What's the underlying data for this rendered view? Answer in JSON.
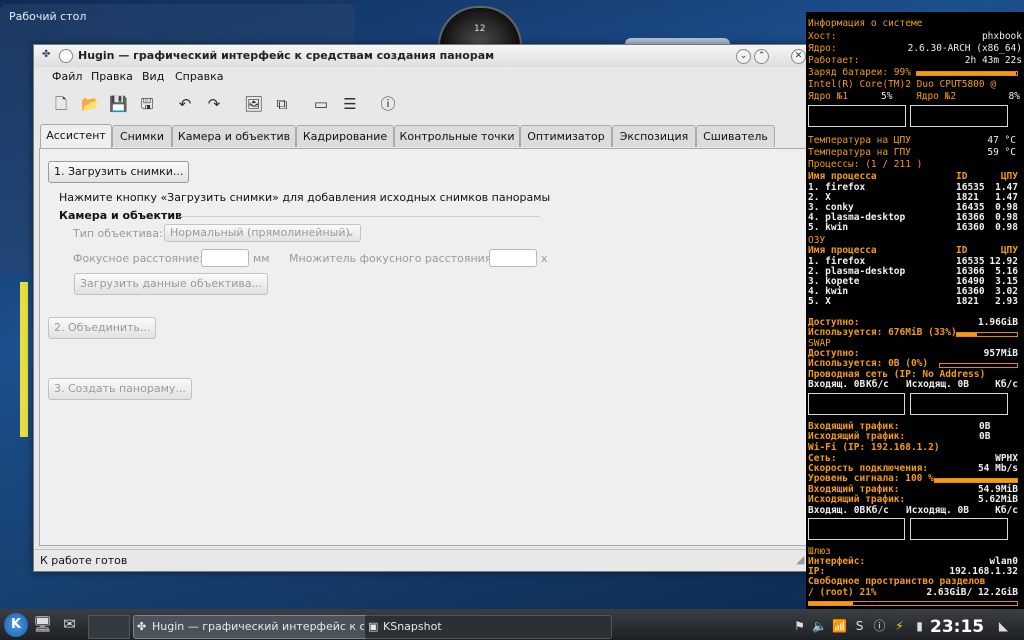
{
  "desktop": {
    "folder_title": "Рабочий стол",
    "clock_label": "12"
  },
  "window": {
    "title": "Hugin — графический интерфейс к средствам создания панорам",
    "menu": [
      "Файл",
      "Правка",
      "Вид",
      "Справка"
    ],
    "tabs": [
      "Ассистент",
      "Снимки",
      "Камера и объектив",
      "Кадрирование",
      "Контрольные точки",
      "Оптимизатор",
      "Экспозиция",
      "Сшиватель"
    ],
    "assistant": {
      "load_images_button": "1. Загрузить снимки...",
      "hint": "Нажмите кнопку «Загрузить снимки» для добавления исходных снимков панорамы",
      "camera_section": "Камера и объектив",
      "lens_type_label": "Тип объектива:",
      "lens_type_value": "Нормальный (прямолинейный)",
      "focal_length_label": "Фокусное расстояние:",
      "focal_unit": "мм",
      "multiplier_label": "Множитель фокусного расстояния:",
      "multiplier_unit": "x",
      "load_lens_button": "Загрузить данные объектива...",
      "align_button": "2. Объединить...",
      "create_button": "3. Создать панораму..."
    },
    "status": "К работе готов"
  },
  "conky": {
    "sysinfo_header": "Информация о системе",
    "host_label": "Хост:",
    "host_value": "phxbook",
    "kernel_label": "Ядро:",
    "kernel_value": "2.6.30-ARCH (x86_64)",
    "uptime_label": "Работает:",
    "uptime_value": "2h 43m 22s",
    "battery_text": "Заряд батареи: 99%",
    "cpu_model": "Intel(R) Core(TM)2 Duo CPU",
    "cpu_code": "T5800 @",
    "core1_text": "Ядро №1",
    "core1_pct": "5%",
    "core2_text": "Ядро №2",
    "core2_pct": "8%",
    "cpu_temp_label": "Температура на ЦПУ",
    "cpu_temp": "47 °C",
    "gpu_temp_label": "Температура на ГПУ",
    "gpu_temp": "59 °C",
    "proc_count": "Процессы: (1  / 211 )",
    "proc_header_name": "Имя процесса",
    "proc_header_id": "ID",
    "proc_header_cpu": "ЦПУ",
    "cpu_procs": [
      [
        "1. firefox",
        "16535",
        "1.47"
      ],
      [
        "2. X",
        "1821",
        "1.47"
      ],
      [
        "3. conky",
        "16435",
        "0.98"
      ],
      [
        "4. plasma-desktop",
        "16366",
        "0.98"
      ],
      [
        "5. kwin",
        "16360",
        "0.98"
      ]
    ],
    "ram_header": "ОЗУ",
    "mem_header_name": "Имя процесса",
    "mem_header_id": "ID",
    "mem_header_cpu": "ЦПУ",
    "mem_procs": [
      [
        "1. firefox",
        "16535",
        "12.92"
      ],
      [
        "2. plasma-desktop",
        "16366",
        "5.16"
      ],
      [
        "3. kopete",
        "16490",
        "3.15"
      ],
      [
        "4. kwin",
        "16360",
        "3.02"
      ],
      [
        "5. X",
        "1821",
        "2.93"
      ]
    ],
    "ram_avail_label": "Доступно:",
    "ram_avail": "1.96GiB",
    "ram_used": "Используется: 676MiB  (33%)",
    "swap_header": "SWAP",
    "swap_avail_label": "Доступно:",
    "swap_avail": "957MiB",
    "swap_used": "Используется: 0B    (0%)",
    "wired_header": "Проводная сеть (IP: No Address)",
    "in_label": "Входящ. 0B",
    "in_unit": "Кб/с",
    "out_label": "Исходящ. 0B",
    "out_unit": "Кб/с",
    "wired_in_traffic_label": "Входящий трафик:",
    "wired_in_traffic": "0B",
    "wired_out_traffic_label": "Исходящий  трафик:",
    "wired_out_traffic": "0B",
    "wifi_header": "Wi-Fi (IP: 192.168.1.2)",
    "ssid_label": "Сеть:",
    "ssid": "WPHX",
    "speed_label": "Скорость подключения:",
    "speed": "54 Mb/s",
    "signal_label": "Уровень сигнала: 100  %",
    "wifi_in_traffic_label": "Входящий трафик:",
    "wifi_in_traffic": "54.9MiB",
    "wifi_out_traffic_label": "Исходящий  трафик:",
    "wifi_out_traffic": "5.62MiB",
    "gateway_header": "Шлюз",
    "iface_label": "Интерфейс:",
    "iface": "wlan0",
    "ip_label": "IP:",
    "ip": "192.168.1.32",
    "disk_header": "Свободное пространство разделов",
    "root_label": "/ (root)  21%",
    "root_value": "2.63GiB/ 12.2GiB",
    "levels": {
      "battery": 0.99,
      "core1": 0.05,
      "core2": 0.08,
      "ram": 0.33,
      "swap": 0.0,
      "signal": 1.0,
      "root": 0.21
    }
  },
  "taskbar": {
    "tasks": [
      "Hugin — графический интерфейс к ср",
      "KSnapshot"
    ],
    "clock": "23:15"
  }
}
